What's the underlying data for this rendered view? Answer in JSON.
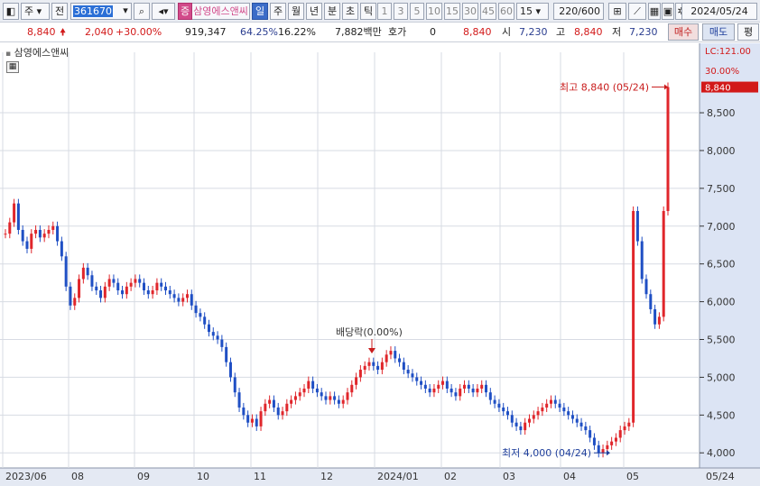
{
  "toolbar": {
    "type_label": "주",
    "prev_label": "전",
    "code": "361670",
    "stock_badge": "증",
    "name": "삼영에스앤씨",
    "periods": [
      "일",
      "주",
      "월",
      "년",
      "분",
      "초",
      "틱"
    ],
    "intervals": [
      "1",
      "3",
      "5",
      "10",
      "15",
      "30",
      "45",
      "60"
    ],
    "interval_value": "15",
    "count": "220/600",
    "date": "2024/05/24"
  },
  "quote": {
    "price": "8,840",
    "change": "2,040",
    "change_pct": "+30.00%",
    "volume": "919,347",
    "ratio": "64.25%",
    "turnover": "16.22%",
    "amount": "7,882백만",
    "hoga_label": "호가",
    "hoga": "0",
    "current": "8,840",
    "open_label": "시",
    "open": "7,230",
    "high_label": "고",
    "high": "8,840",
    "low_label": "저",
    "low": "7,230",
    "buy_label": "매수",
    "sell_label": "매도",
    "avg_label": "평"
  },
  "legend": {
    "name": "삼영에스앤씨"
  },
  "colors": {
    "up": "#e0262b",
    "down": "#1f4fc4",
    "grid": "#d7dbe3",
    "axis_bg": "#dce4f4"
  },
  "chart_data": {
    "type": "candlestick",
    "yaxis": {
      "ticks": [
        4000,
        4500,
        5000,
        5500,
        6000,
        6500,
        7000,
        7500,
        8000,
        8500
      ],
      "tick_labels": [
        "4,000",
        "4,500",
        "5,000",
        "5,500",
        "6,000",
        "6,500",
        "7,000",
        "7,500",
        "8,000",
        "8,500"
      ],
      "range": [
        3800,
        9300
      ],
      "top_labels": [
        "LC:121.00",
        "30.00%"
      ]
    },
    "xaxis": {
      "ticks": [
        "2023/06",
        "08",
        "09",
        "10",
        "11",
        "12",
        "2024/01",
        "02",
        "03",
        "04",
        "05",
        "05/24"
      ]
    },
    "last_price_label": "8,840",
    "annotations": {
      "high": "최고 8,840 (05/24)",
      "low": "최저 4,000 (04/24)",
      "dividend": "배당락(0.00%)"
    },
    "close_series": [
      6900,
      7050,
      7300,
      6950,
      6800,
      6700,
      6900,
      6950,
      6850,
      6900,
      6950,
      7000,
      6800,
      6600,
      6200,
      5950,
      6050,
      6300,
      6450,
      6350,
      6200,
      6150,
      6050,
      6200,
      6300,
      6250,
      6150,
      6100,
      6200,
      6250,
      6300,
      6250,
      6150,
      6100,
      6150,
      6250,
      6200,
      6150,
      6100,
      6050,
      6000,
      6050,
      6100,
      5950,
      5850,
      5800,
      5700,
      5600,
      5550,
      5500,
      5400,
      5200,
      5000,
      4800,
      4600,
      4500,
      4400,
      4450,
      4350,
      4550,
      4650,
      4700,
      4600,
      4500,
      4550,
      4650,
      4700,
      4750,
      4800,
      4850,
      4950,
      4850,
      4800,
      4750,
      4700,
      4750,
      4700,
      4650,
      4700,
      4800,
      4900,
      5000,
      5100,
      5150,
      5200,
      5150,
      5100,
      5200,
      5300,
      5350,
      5250,
      5200,
      5100,
      5050,
      5000,
      4950,
      4900,
      4850,
      4800,
      4850,
      4900,
      4950,
      4850,
      4800,
      4750,
      4850,
      4900,
      4850,
      4800,
      4850,
      4900,
      4800,
      4700,
      4650,
      4600,
      4550,
      4500,
      4400,
      4350,
      4300,
      4400,
      4450,
      4500,
      4550,
      4600,
      4650,
      4700,
      4650,
      4600,
      4550,
      4500,
      4450,
      4400,
      4350,
      4300,
      4200,
      4100,
      4000,
      4050,
      4100,
      4150,
      4200,
      4300,
      4350,
      4400,
      7200,
      6800,
      6300,
      6100,
      5900,
      5700,
      5800,
      7200,
      8840
    ]
  }
}
